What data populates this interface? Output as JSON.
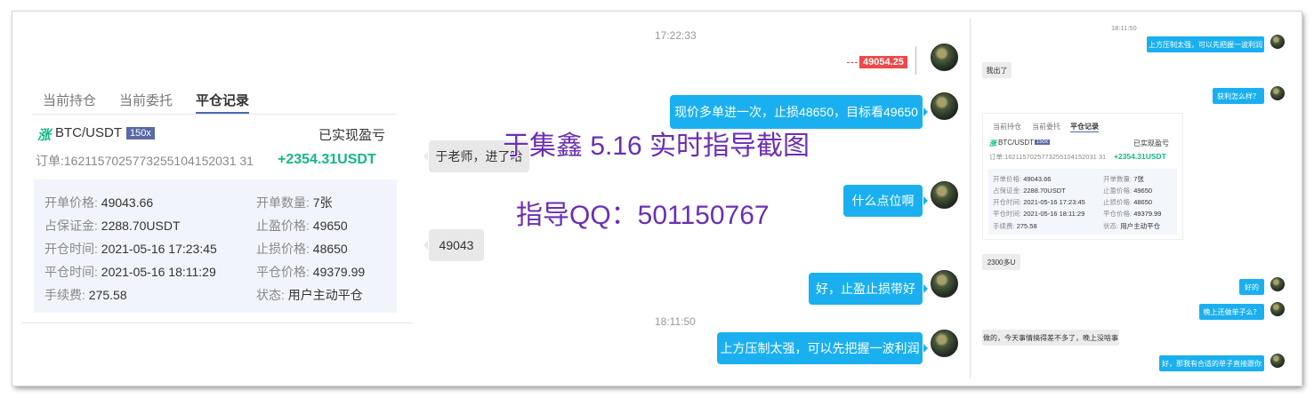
{
  "trade_panel": {
    "tabs": [
      "当前持仓",
      "当前委托",
      "平仓记录"
    ],
    "active_tab": "平仓记录",
    "symbol": "BTC/USDT",
    "leverage": "150x",
    "pnl_label": "已实现盈亏",
    "order_id": "订单:1621157025773255104152031 31",
    "pnl_value": "+2354.31USDT",
    "fields": [
      {
        "k": "开单价格:",
        "v": "49043.66"
      },
      {
        "k": "开单数量:",
        "v": "7张"
      },
      {
        "k": "占保证金:",
        "v": "2288.70USDT"
      },
      {
        "k": "止盈价格:",
        "v": "49650"
      },
      {
        "k": "开仓时间:",
        "v": "2021-05-16 17:23:45"
      },
      {
        "k": "止损价格:",
        "v": "48650"
      },
      {
        "k": "平仓时间:",
        "v": "2021-05-16 18:11:29"
      },
      {
        "k": "平仓价格:",
        "v": "49379.99"
      },
      {
        "k": "手续费:",
        "v": "275.58"
      },
      {
        "k": "状态:",
        "v": "用户主动平仓"
      }
    ]
  },
  "chat": {
    "time1": "17:22:33",
    "price_tag": "49054.25",
    "msg1": "现价多单进一次，止损48650，目标看49650",
    "msg2": "于老师，进了哈",
    "msg3": "什么点位啊",
    "msg4": "49043",
    "msg5": "好，止盈止损带好",
    "time2": "18:11:50",
    "msg6": "上方压制太强，可以先把握一波利润"
  },
  "watermark": {
    "line1": "于集鑫 5.16 实时指导截图",
    "line2": "指导QQ：501150767"
  },
  "mini": {
    "time": "18:11:50",
    "m1": "上方压制太强，可以先把握一波利润",
    "m2": "我出了",
    "m3": "获利怎么样？",
    "tabs": [
      "当前持仓",
      "当前委托",
      "平仓记录"
    ],
    "symbol": "BTC/USDT",
    "leverage": "150x",
    "pnl_label": "已实现盈亏",
    "order_id": "订单:1621157025773255104152031 31",
    "pnl_value": "+2354.31USDT",
    "fields": [
      {
        "k": "开单价格:",
        "v": "49043.66"
      },
      {
        "k": "开单数量:",
        "v": "7张"
      },
      {
        "k": "占保证金:",
        "v": "2288.70USDT"
      },
      {
        "k": "止盈价格:",
        "v": "49650"
      },
      {
        "k": "开仓时间:",
        "v": "2021-05-16 17:23:45"
      },
      {
        "k": "止损价格:",
        "v": "48650"
      },
      {
        "k": "平仓时间:",
        "v": "2021-05-16 18:11:29"
      },
      {
        "k": "平仓价格:",
        "v": "49379.99"
      },
      {
        "k": "手续费:",
        "v": "275.58"
      },
      {
        "k": "状态:",
        "v": "用户主动平仓"
      }
    ],
    "m4": "2300多U",
    "m5": "好的",
    "m6": "晚上还做单子么？",
    "m7": "做的，今天事情搞得差不多了，晚上没啥事",
    "m8": "好，那我有合适的单子直接跟你"
  }
}
